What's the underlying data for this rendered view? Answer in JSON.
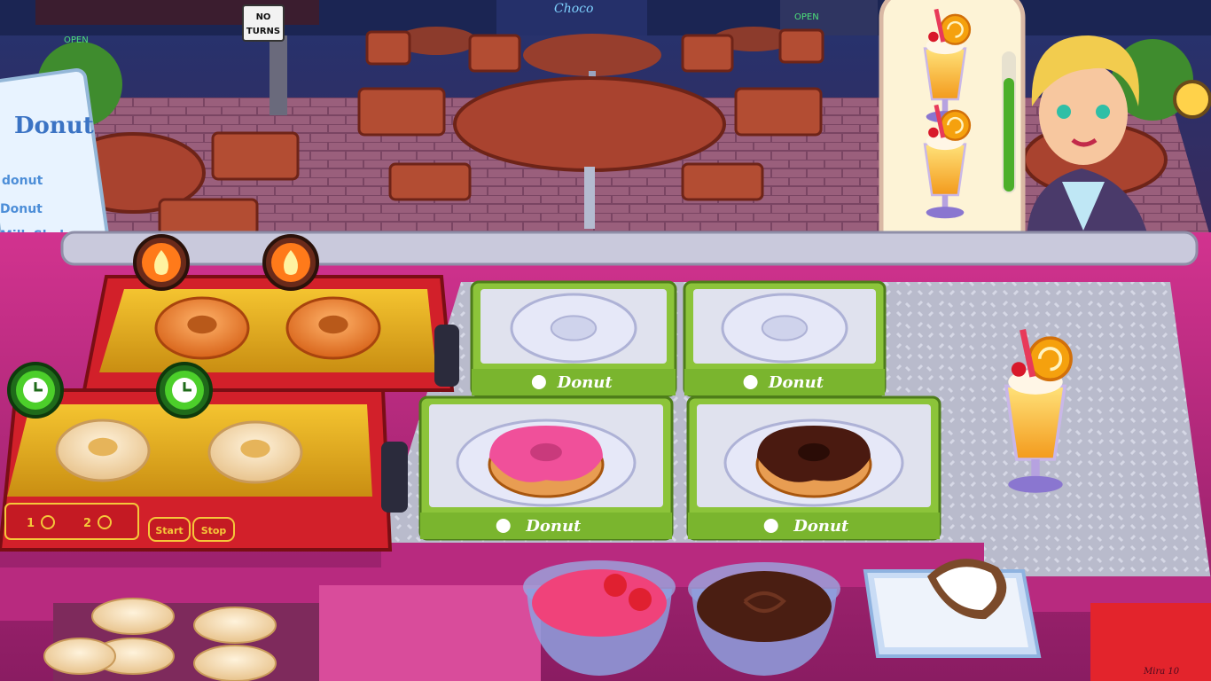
{
  "scene": {
    "sign_no_turns": [
      "NO",
      "TURNS"
    ],
    "neon_choco": "Choco",
    "shop_open_left": "OPEN",
    "shop_open_right": "OPEN",
    "menu_board": {
      "title": "Donut",
      "items": [
        "donut",
        "Donut",
        "Milk Shake"
      ]
    }
  },
  "order": {
    "items": [
      {
        "icon": "milkshake-icon"
      },
      {
        "icon": "milkshake-icon"
      }
    ],
    "patience": 0.82,
    "colors": {
      "patience": "#4caf2a",
      "card": "#fdf3d6"
    }
  },
  "fryer_back": {
    "slots": [
      {
        "item": "glazed-donut",
        "state": "fire-icon"
      },
      {
        "item": "glazed-donut",
        "state": "fire-icon"
      }
    ]
  },
  "fryer_front": {
    "slots": [
      {
        "item": "plain-donut",
        "state": "clock-icon"
      },
      {
        "item": "plain-donut",
        "state": "clock-icon"
      }
    ],
    "panel": {
      "mode1": "1",
      "mode2": "2",
      "start": "Start",
      "stop": "Stop"
    }
  },
  "trays": [
    {
      "label": "Donut",
      "content": "empty-plate"
    },
    {
      "label": "Donut",
      "content": "empty-plate"
    },
    {
      "label": "Donut",
      "content": "pink-glazed-donut"
    },
    {
      "label": "Donut",
      "content": "chocolate-glazed-donut"
    }
  ],
  "counter": {
    "ready_item": "milkshake-icon"
  },
  "toppings": [
    {
      "name": "strawberry-glaze-bowl"
    },
    {
      "name": "chocolate-glaze-bowl"
    },
    {
      "name": "coconut-flakes-box"
    }
  ],
  "watermark": "Mira 10"
}
